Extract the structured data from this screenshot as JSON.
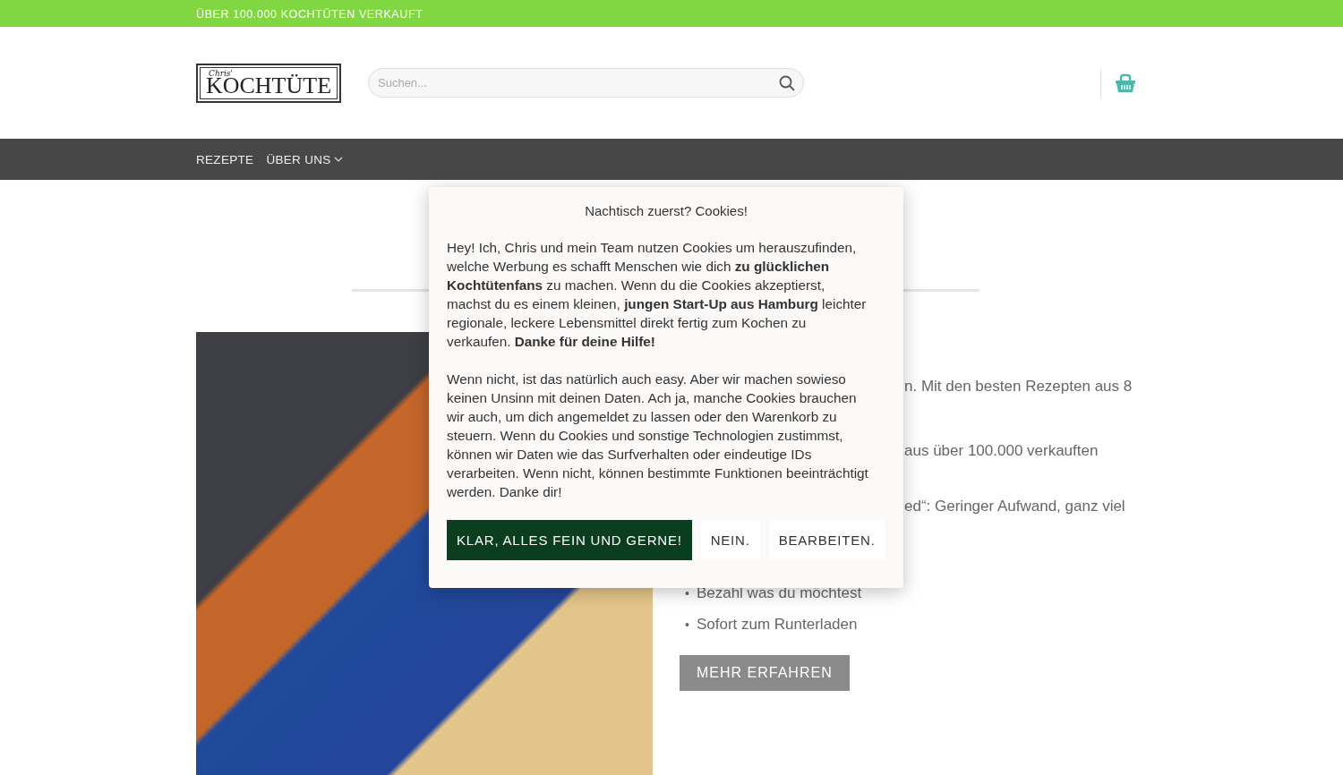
{
  "top_bar": {
    "text": "ÜBER 100.000 KOCHTÜTEN VERKAUFT"
  },
  "header": {
    "logo": {
      "script": "Chris'",
      "name": "KOCHTÜTE"
    },
    "search": {
      "placeholder": "Suchen..."
    }
  },
  "nav": {
    "items": [
      {
        "label": "REZEPTE",
        "has_dropdown": false
      },
      {
        "label": "ÜBER UNS",
        "has_dropdown": true
      }
    ]
  },
  "content": {
    "fragments": [
      "n. Mit den besten Rezepten aus 8",
      "aus über 100.000 verkauften",
      "ed“: Geringer Aufwand, ganz viel"
    ],
    "bullets": [
      {
        "marker": "•",
        "text": "Bezahl was du möchtest"
      },
      {
        "marker": "•",
        "text": "Sofort zum Runterladen"
      }
    ],
    "cta": "MEHR ERFAHREN"
  },
  "cookie_dialog": {
    "title": "Nachtisch zuerst? Cookies!",
    "paragraphs": [
      "Hey! Ich, Chris und mein Team nutzen Cookies um herauszufinden, welche Werbung es schafft Menschen wie dich **zu glücklichen Kochtütenfans** zu machen. Wenn du die Cookies akzeptierst, machst du es einem kleinen, **jungen Start-Up aus Hamburg** leichter regionale, leckere Lebensmittel direkt fertig zum Kochen zu verkaufen. **Danke für deine Hilfe!**",
      "Wenn nicht, ist das natürlich auch easy. Aber wir machen sowieso keinen Unsinn mit deinen Daten. Ach ja, manche Cookies brauchen wir auch, um dich angemeldet zu lassen oder den Warenkorb zu steuern. Wenn du Cookies und sonstige Technologien zustimmst, können wir Daten wie das Surfverhalten oder eindeutige IDs verarbeiten. Wenn nicht, können bestimmte Funktionen beeinträchtigt werden. Danke dir!"
    ],
    "buttons": [
      {
        "label": "KLAR, ALLES FEIN UND GERNE!",
        "kind": "primary"
      },
      {
        "label": "NEIN.",
        "kind": "secondary"
      },
      {
        "label": "BEARBEITEN.",
        "kind": "secondary"
      }
    ]
  }
}
